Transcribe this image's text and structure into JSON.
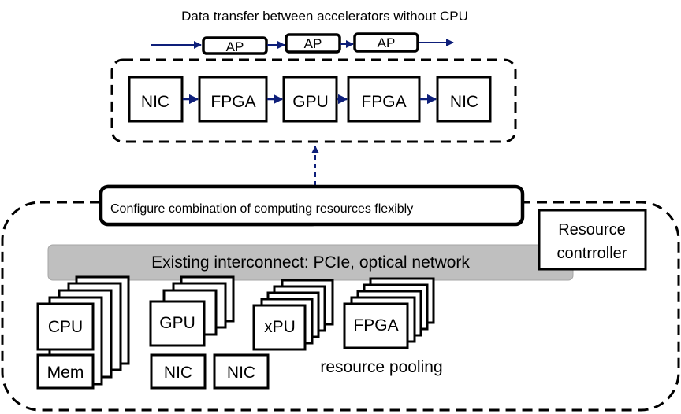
{
  "top": {
    "caption": "Data transfer between accelerators without CPU",
    "ap_boxes": [
      "AP",
      "AP",
      "AP"
    ],
    "chain": [
      "NIC",
      "FPGA",
      "GPU",
      "FPGA",
      "NIC"
    ]
  },
  "configure_label": "Configure combination of computing resources flexibly",
  "resource_controller": [
    "Resource",
    "contrroller"
  ],
  "interconnect_label": "Existing interconnect: PCIe, optical network",
  "pool": {
    "cpu": "CPU",
    "mem": "Mem",
    "gpu": "GPU",
    "nic1": "NIC",
    "nic2": "NIC",
    "xpu": "xPU",
    "fpga": "FPGA",
    "caption": "resource pooling"
  },
  "colors": {
    "arrow": "#0e1f7a",
    "interconnect_fill": "#bfbfbf",
    "interconnect_stroke": "#a6a6a6"
  }
}
